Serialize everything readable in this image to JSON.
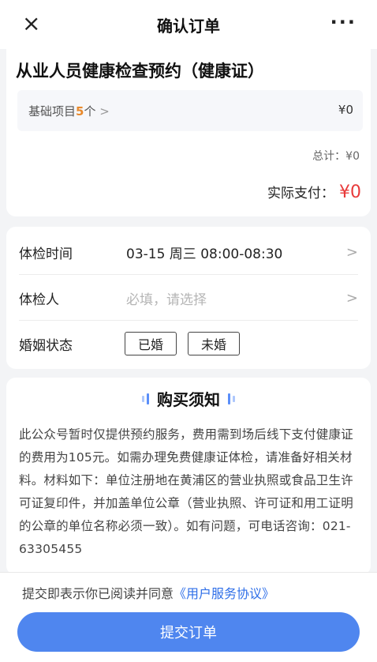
{
  "nav": {
    "close_icon": "×",
    "title": "确认订单",
    "more_icon": "···"
  },
  "order": {
    "title": "从业人员健康检查预约（健康证）",
    "base_label": "基础项目",
    "base_count": "5",
    "base_unit": "个",
    "base_chevron": ">",
    "base_price": "¥0",
    "total": "总计：¥0",
    "pay_label": "实际支付：",
    "pay_amount": "¥0"
  },
  "info": {
    "time_label": "体检时间",
    "time_value": "03-15 周三 08:00-08:30",
    "person_label": "体检人",
    "person_placeholder": "必填，请选择",
    "marital_label": "婚姻状态",
    "marital_options": [
      "已婚",
      "未婚"
    ],
    "chevron": ">"
  },
  "notice": {
    "title": "购买须知",
    "body": "此公众号暂时仅提供预约服务，费用需到场后线下支付健康证的费用为105元。如需办理免费健康证体检，请准备好相关材料。材料如下：单位注册地在黄浦区的营业执照或食品卫生许可证复印件，并加盖单位公章（营业执照、许可证和用工证明的公章的单位名称必须一致）。如有问题，可电话咨询：021-63305455"
  },
  "footer": {
    "agree_text": "提交即表示你已阅读并同意",
    "agree_link": "《用户服务协议》",
    "submit_label": "提交订单"
  },
  "colors": {
    "accent": "#4f86ef",
    "price": "#e83a3a",
    "count": "#e8892b",
    "link": "#2f6fe8"
  }
}
